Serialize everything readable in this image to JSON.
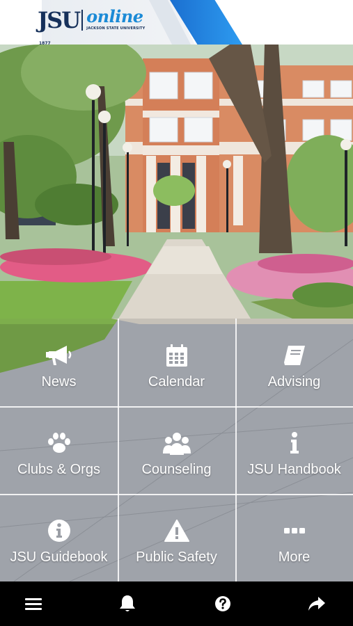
{
  "header": {
    "logo": {
      "jsu": "JSU",
      "year": "1877",
      "online": "online",
      "subtitle": "JACKSON STATE UNIVERSITY"
    },
    "colors": {
      "navy": "#16305a",
      "blue": "#1b8ad6",
      "accent": "#2d9bf0"
    }
  },
  "tiles": [
    {
      "label": "News",
      "icon": "megaphone-icon"
    },
    {
      "label": "Calendar",
      "icon": "calendar-icon"
    },
    {
      "label": "Advising",
      "icon": "book-icon"
    },
    {
      "label": "Clubs & Orgs",
      "icon": "paw-icon"
    },
    {
      "label": "Counseling",
      "icon": "group-icon"
    },
    {
      "label": "JSU Handbook",
      "icon": "info-icon"
    },
    {
      "label": "JSU Guidebook",
      "icon": "info-circle-icon"
    },
    {
      "label": "Public Safety",
      "icon": "warning-icon"
    },
    {
      "label": "More",
      "icon": "ellipsis-icon"
    }
  ],
  "bottom_bar": [
    {
      "icon": "menu-icon"
    },
    {
      "icon": "bell-icon"
    },
    {
      "icon": "help-icon"
    },
    {
      "icon": "share-icon"
    }
  ]
}
